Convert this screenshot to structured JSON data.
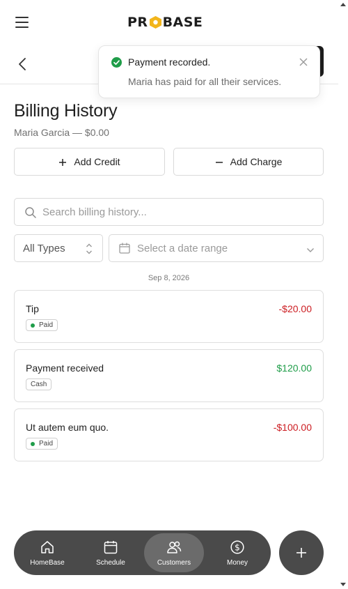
{
  "brand": {
    "logo_pre": "PR",
    "logo_post": "BASE",
    "accent": "#f2b51c"
  },
  "toast": {
    "title": "Payment recorded.",
    "description": "Maria has paid for all their services.",
    "icon": "check-circle-icon"
  },
  "page": {
    "title": "Billing History",
    "customer": "Maria Garcia — $0.00"
  },
  "actions": {
    "add_credit": "Add Credit",
    "add_charge": "Add Charge"
  },
  "search": {
    "placeholder": "Search billing history..."
  },
  "filters": {
    "type_value": "All Types",
    "date_placeholder": "Select a date range"
  },
  "history": {
    "date": "Sep 8, 2026",
    "items": [
      {
        "description": "Tip",
        "amount": "-$20.00",
        "kind": "negative",
        "badge": "Paid",
        "badge_dot": true
      },
      {
        "description": "Payment received",
        "amount": "$120.00",
        "kind": "positive",
        "badge": "Cash",
        "badge_dot": false
      },
      {
        "description": "Ut autem eum quo.",
        "amount": "-$100.00",
        "kind": "negative",
        "badge": "Paid",
        "badge_dot": true
      }
    ]
  },
  "nav": {
    "items": [
      {
        "label": "HomeBase",
        "icon": "home-icon"
      },
      {
        "label": "Schedule",
        "icon": "calendar-icon"
      },
      {
        "label": "Customers",
        "icon": "users-icon",
        "active": true
      },
      {
        "label": "Money",
        "icon": "dollar-icon"
      }
    ]
  },
  "colors": {
    "negative": "#cc1d22",
    "positive": "#1f9d49",
    "nav_bg": "#4a4a4a"
  }
}
